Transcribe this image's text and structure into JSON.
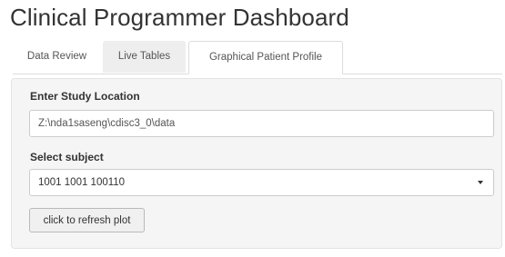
{
  "page": {
    "title": "Clinical Programmer Dashboard"
  },
  "tabs": [
    {
      "label": "Data Review",
      "active": false
    },
    {
      "label": "Live Tables",
      "active": false
    },
    {
      "label": "Graphical Patient Profile",
      "active": true
    }
  ],
  "form": {
    "study_location_label": "Enter Study Location",
    "study_location_value": "Z:\\nda1saseng\\cdisc3_0\\data",
    "subject_label": "Select subject",
    "subject_value": "1001 1001 100110",
    "refresh_button_label": "click to refresh plot"
  },
  "icons": {
    "dropdown": "chevron-down-icon"
  },
  "colors": {
    "well_background": "#f5f5f5",
    "inactive_tab_background": "#eeeeee",
    "border": "#dddddd"
  }
}
